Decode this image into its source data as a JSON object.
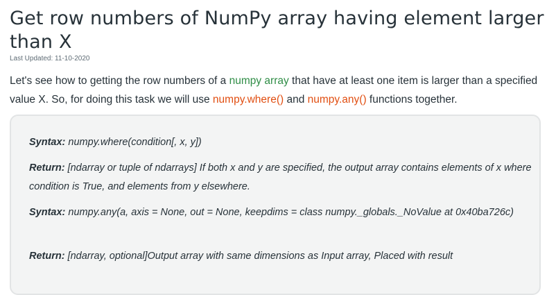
{
  "article": {
    "title": "Get row numbers of NumPy array having element larger than X",
    "last_updated": "Last Updated: 11-10-2020",
    "intro": {
      "part1": "Let's see how to getting the row numbers of a ",
      "link_numpy_array": "numpy array",
      "part2": " that have at least one item is larger than a specified value X. So, for doing this task we will use ",
      "func_where": "numpy.where()",
      "part3": " and ",
      "func_any": "numpy.any()",
      "part4": " functions together."
    },
    "syntax_box": {
      "syntax1_label": "Syntax:",
      "syntax1_value": " numpy.where(condition[, x, y])",
      "return1_label": "Return:",
      "return1_value": " [ndarray or tuple of ndarrays] If both x and y are specified, the output array contains elements of x where condition is True, and elements from y elsewhere.",
      "syntax2_label": "Syntax:",
      "syntax2_value": " numpy.any(a, axis = None, out = None, keepdims = class numpy._globals._NoValue at 0x40ba726c)",
      "return2_label": "Return:",
      "return2_value": " [ndarray, optional]Output array with same dimensions as Input array, Placed with result"
    }
  },
  "colors": {
    "text": "#273239",
    "link_green": "#2f8d46",
    "code_red": "#e14e11",
    "box_bg": "#f3f4f4",
    "box_border": "#e2e4e5"
  }
}
